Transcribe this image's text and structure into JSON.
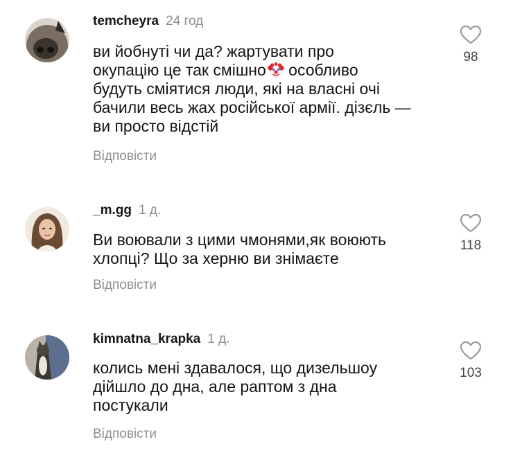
{
  "comments": [
    {
      "username": "temcheyra",
      "time": "24 год",
      "lines": [
        "ви йобнуті чи да? жартувати про",
        "окупацію це так смішно",
        "будуть сміятися люди, які на власні очі",
        "бачили весь жах російської армії. дізєль —",
        "ви просто відстій"
      ],
      "line2_tail": " особливо",
      "emoji": "clown-face",
      "reply": "Відповісти",
      "likes": "98"
    },
    {
      "username": "_m.gg",
      "time": "1 д.",
      "lines": [
        "Ви воювали з цими чмонями,як воюють",
        "хлопці? Що за херню ви знімаєте"
      ],
      "reply": "Відповісти",
      "likes": "118"
    },
    {
      "username": "kimnatna_krapka",
      "time": "1 д.",
      "lines": [
        "колись мені здавалося, що дизельшоу",
        "дійшло до дна, але раптом з дна",
        "постукали"
      ],
      "reply": "Відповісти",
      "likes": "103"
    }
  ],
  "icons": {
    "like": "heart-outline-icon",
    "emoji": "clown-face-icon"
  },
  "colors": {
    "text": "#141414",
    "muted": "#8e8e8e",
    "heart_stroke": "#9a9a9a"
  }
}
